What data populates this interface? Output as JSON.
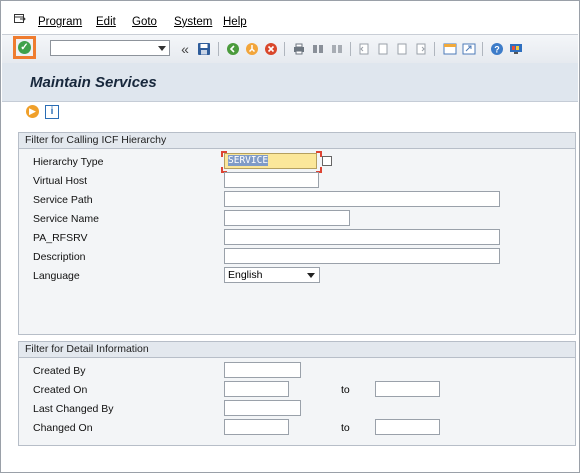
{
  "menu": {
    "program": "Program",
    "edit": "Edit",
    "goto": "Goto",
    "system": "System",
    "help": "Help"
  },
  "toolbar": {
    "command_field_value": "",
    "icons": [
      "ok-icon",
      "back-icon",
      "save-icon",
      "back-green-icon",
      "exit-icon",
      "cancel-icon",
      "print-icon",
      "find-icon",
      "find-next-icon",
      "first-page-icon",
      "prev-page-icon",
      "next-page-icon",
      "last-page-icon",
      "create-session-icon",
      "shortcut-icon",
      "help-icon",
      "customize-icon"
    ]
  },
  "title": "Maintain Services",
  "group1": {
    "header": "Filter for Calling ICF Hierarchy",
    "rows": [
      {
        "label": "Hierarchy Type",
        "value": "SERVICE"
      },
      {
        "label": "Virtual Host",
        "value": ""
      },
      {
        "label": "Service Path",
        "value": ""
      },
      {
        "label": "Service Name",
        "value": ""
      },
      {
        "label": "PA_RFSRV",
        "value": ""
      },
      {
        "label": "Description",
        "value": ""
      },
      {
        "label": "Language",
        "value": "English"
      }
    ]
  },
  "group2": {
    "header": "Filter for Detail Information",
    "rows": [
      {
        "label": "Created By",
        "value": ""
      },
      {
        "label": "Created On",
        "value": "",
        "to_label": "to",
        "to_value": ""
      },
      {
        "label": "Last Changed By",
        "value": ""
      },
      {
        "label": "Changed On",
        "value": "",
        "to_label": "to",
        "to_value": ""
      }
    ]
  },
  "colors": {
    "ok_highlight": "#ef7c2f",
    "title_bg": "#dfe6ee",
    "field_highlight": "#fbe79a"
  }
}
